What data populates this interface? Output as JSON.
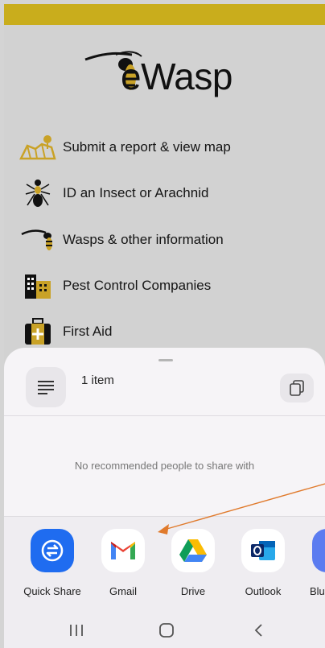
{
  "app": {
    "logo_text": "eWasp"
  },
  "menu": [
    {
      "label": "Submit a report & view map",
      "icon": "map-pin-icon"
    },
    {
      "label": "ID an Insect or Arachnid",
      "icon": "ant-icon"
    },
    {
      "label": "Wasps & other information",
      "icon": "wasp-icon"
    },
    {
      "label": "Pest Control Companies",
      "icon": "buildings-icon"
    },
    {
      "label": "First Aid",
      "icon": "first-aid-kit-icon"
    }
  ],
  "share_sheet": {
    "item_count": "1 item",
    "no_people_text": "No recommended people to share with",
    "apps": [
      {
        "label": "Quick Share",
        "icon": "quick-share-icon"
      },
      {
        "label": "Gmail",
        "icon": "gmail-icon"
      },
      {
        "label": "Drive",
        "icon": "drive-icon"
      },
      {
        "label": "Outlook",
        "icon": "outlook-icon"
      },
      {
        "label": "Blu",
        "icon": "bluetooth-icon"
      }
    ]
  },
  "colors": {
    "top_bar": "#c9ad1c",
    "accent_gold": "#c9a227",
    "arrow": "#e07a2c"
  },
  "nav": [
    "recent-apps",
    "home",
    "back"
  ]
}
